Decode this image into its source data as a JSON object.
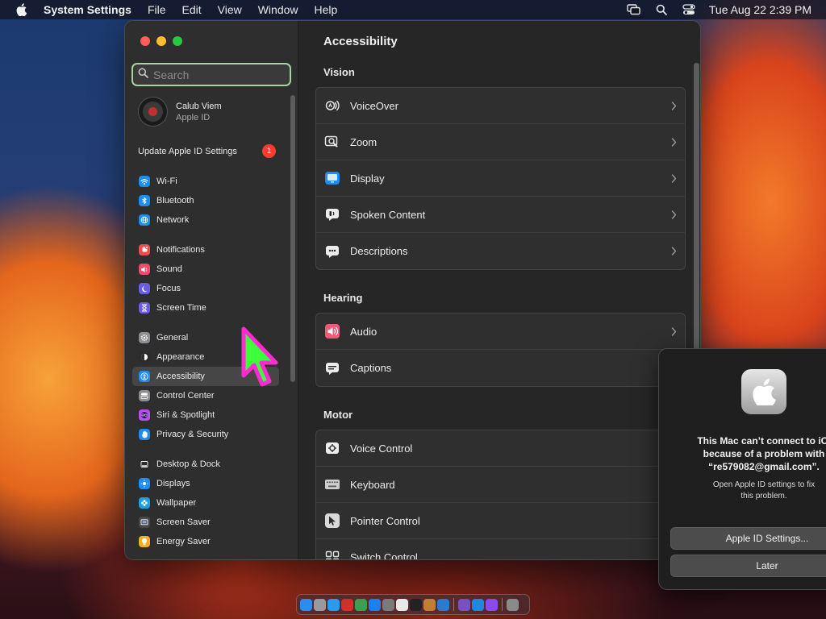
{
  "menubar": {
    "app_name": "System Settings",
    "menus": [
      "File",
      "Edit",
      "View",
      "Window",
      "Help"
    ],
    "clock": "Tue Aug 22  2:39 PM",
    "status_icons": [
      "display-mirroring-icon",
      "spotlight-search-icon",
      "control-center-icon"
    ]
  },
  "window": {
    "search": {
      "value": "",
      "placeholder": "Search"
    },
    "profile": {
      "name": "Calub Viem",
      "subtitle": "Apple ID"
    },
    "update": {
      "label": "Update Apple ID Settings",
      "badge": "1"
    },
    "sidebar_groups": [
      [
        {
          "label": "Wi-Fi",
          "icon": "wifi-icon",
          "color": "#1e8cf0"
        },
        {
          "label": "Bluetooth",
          "icon": "bluetooth-icon",
          "color": "#1e8cf0"
        },
        {
          "label": "Network",
          "icon": "globe-icon",
          "color": "#1e8cf0"
        }
      ],
      [
        {
          "label": "Notifications",
          "icon": "bell-icon",
          "color": "#f04b4b"
        },
        {
          "label": "Sound",
          "icon": "speaker-icon",
          "color": "#f04b6b"
        },
        {
          "label": "Focus",
          "icon": "moon-icon",
          "color": "#6b5ce0"
        },
        {
          "label": "Screen Time",
          "icon": "hourglass-icon",
          "color": "#6b5ce0"
        }
      ],
      [
        {
          "label": "General",
          "icon": "gear-icon",
          "color": "#8e8e93"
        },
        {
          "label": "Appearance",
          "icon": "appearance-icon",
          "color": "#2b2b2b"
        },
        {
          "label": "Accessibility",
          "icon": "accessibility-icon",
          "color": "#1e8cf0",
          "active": true
        },
        {
          "label": "Control Center",
          "icon": "control-center-icon",
          "color": "#8e8e93"
        },
        {
          "label": "Siri & Spotlight",
          "icon": "siri-icon",
          "color": "#c04cf0"
        },
        {
          "label": "Privacy & Security",
          "icon": "hand-icon",
          "color": "#1e8cf0"
        }
      ],
      [
        {
          "label": "Desktop & Dock",
          "icon": "dock-icon",
          "color": "#2b2b2b"
        },
        {
          "label": "Displays",
          "icon": "sun-icon",
          "color": "#1e8cf0"
        },
        {
          "label": "Wallpaper",
          "icon": "flower-icon",
          "color": "#1ea0e0"
        },
        {
          "label": "Screen Saver",
          "icon": "screensaver-icon",
          "color": "#4a4a4a"
        },
        {
          "label": "Energy Saver",
          "icon": "lightbulb-icon",
          "color": "#f0b020"
        }
      ]
    ],
    "content": {
      "title": "Accessibility",
      "sections": [
        {
          "label": "Vision",
          "items": [
            {
              "label": "VoiceOver",
              "icon": "voiceover-icon"
            },
            {
              "label": "Zoom",
              "icon": "zoom-icon"
            },
            {
              "label": "Display",
              "icon": "display-icon"
            },
            {
              "label": "Spoken Content",
              "icon": "spoken-content-icon"
            },
            {
              "label": "Descriptions",
              "icon": "descriptions-icon"
            }
          ]
        },
        {
          "label": "Hearing",
          "items": [
            {
              "label": "Audio",
              "icon": "audio-icon"
            },
            {
              "label": "Captions",
              "icon": "captions-icon"
            }
          ]
        },
        {
          "label": "Motor",
          "items": [
            {
              "label": "Voice Control",
              "icon": "voice-control-icon"
            },
            {
              "label": "Keyboard",
              "icon": "keyboard-icon"
            },
            {
              "label": "Pointer Control",
              "icon": "pointer-control-icon"
            },
            {
              "label": "Switch Control",
              "icon": "switch-control-icon"
            }
          ]
        }
      ]
    }
  },
  "dialog": {
    "message_line1": "This Mac can’t connect to iCl",
    "message_line2": "because of a problem with",
    "message_line3": "“re579082@gmail.com”.",
    "sub_line1": "Open Apple ID settings to fix",
    "sub_line2": "this problem.",
    "primary_button": "Apple ID Settings...",
    "secondary_button": "Later"
  },
  "dock": {
    "apps": [
      {
        "name": "finder",
        "color": "#2a8cf0"
      },
      {
        "name": "launchpad",
        "color": "#9a9a9a"
      },
      {
        "name": "safari",
        "color": "#2a9af0"
      },
      {
        "name": "photo-booth",
        "color": "#d0302a"
      },
      {
        "name": "chrome",
        "color": "#3aa050"
      },
      {
        "name": "app-store",
        "color": "#1e7ff0"
      },
      {
        "name": "system-settings",
        "color": "#7a7a7a"
      },
      {
        "name": "textedit",
        "color": "#e8e8e8"
      },
      {
        "name": "terminal",
        "color": "#222222"
      },
      {
        "name": "brush-app",
        "color": "#c08030"
      },
      {
        "name": "vscode",
        "color": "#2a7ad0"
      },
      {
        "name": "visual-studio",
        "color": "#7a50c0"
      },
      {
        "name": "onedrive",
        "color": "#1e88e0"
      },
      {
        "name": "podcasts",
        "color": "#8a4af0"
      },
      {
        "name": "trash",
        "color": "#8a8a8a"
      }
    ]
  },
  "colors": {
    "search_focus": "#a5d4a2",
    "cursor_fill": "#3aff3a",
    "cursor_outline": "#ff2ad4",
    "badge": "#ff3b30"
  }
}
